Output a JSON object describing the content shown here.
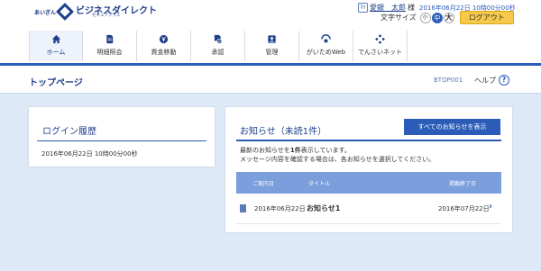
{
  "brand": {
    "prefix": "あいぎん",
    "name": "ビジネスダイレクト",
    "sub": "セキュアプラス"
  },
  "user": {
    "icon_text": "ﾏｲ",
    "name": "愛銀　太郎",
    "honorific": "様",
    "last_login": "2016年06月22日 10時00分00秒"
  },
  "font_size": {
    "label": "文字サイズ",
    "small": "小",
    "medium": "中",
    "large": "大",
    "selected": "中"
  },
  "logout_label": "ログアウト",
  "nav": [
    {
      "label": "ホーム",
      "icon": "home-icon"
    },
    {
      "label": "明細照会",
      "icon": "document-icon"
    },
    {
      "label": "資金移動",
      "icon": "yen-icon"
    },
    {
      "label": "承認",
      "icon": "approval-icon"
    },
    {
      "label": "管理",
      "icon": "admin-icon"
    },
    {
      "label": "がいためWeb",
      "icon": "globe-icon"
    },
    {
      "label": "でんさいネット",
      "icon": "network-icon"
    }
  ],
  "page": {
    "title": "トップページ",
    "id": "BTOP001",
    "help_label": "ヘルプ",
    "help_icon": "?"
  },
  "login_history": {
    "title": "ログイン履歴",
    "value": "2016年06月22日 10時00分00秒"
  },
  "notices": {
    "title": "お知らせ（未読1件）",
    "all_button": "すべてのお知らせを表示",
    "message_pre": "最新のお知らせを",
    "message_count": "1件",
    "message_post": "表示しています。",
    "message_line2": "メッセージ内容を確認する場合は、各お知らせを選択してください。",
    "columns": [
      "ご案内日",
      "タイトル",
      "掲載終了日"
    ],
    "rows": [
      {
        "date": "2016年06月22日",
        "title": "お知らせ1",
        "end_date": "2016年07月22日"
      }
    ]
  },
  "colors": {
    "primary": "#2b5db8",
    "accent": "#f6c94a",
    "background": "#dde9f6",
    "table_header": "#7b9fdd"
  }
}
